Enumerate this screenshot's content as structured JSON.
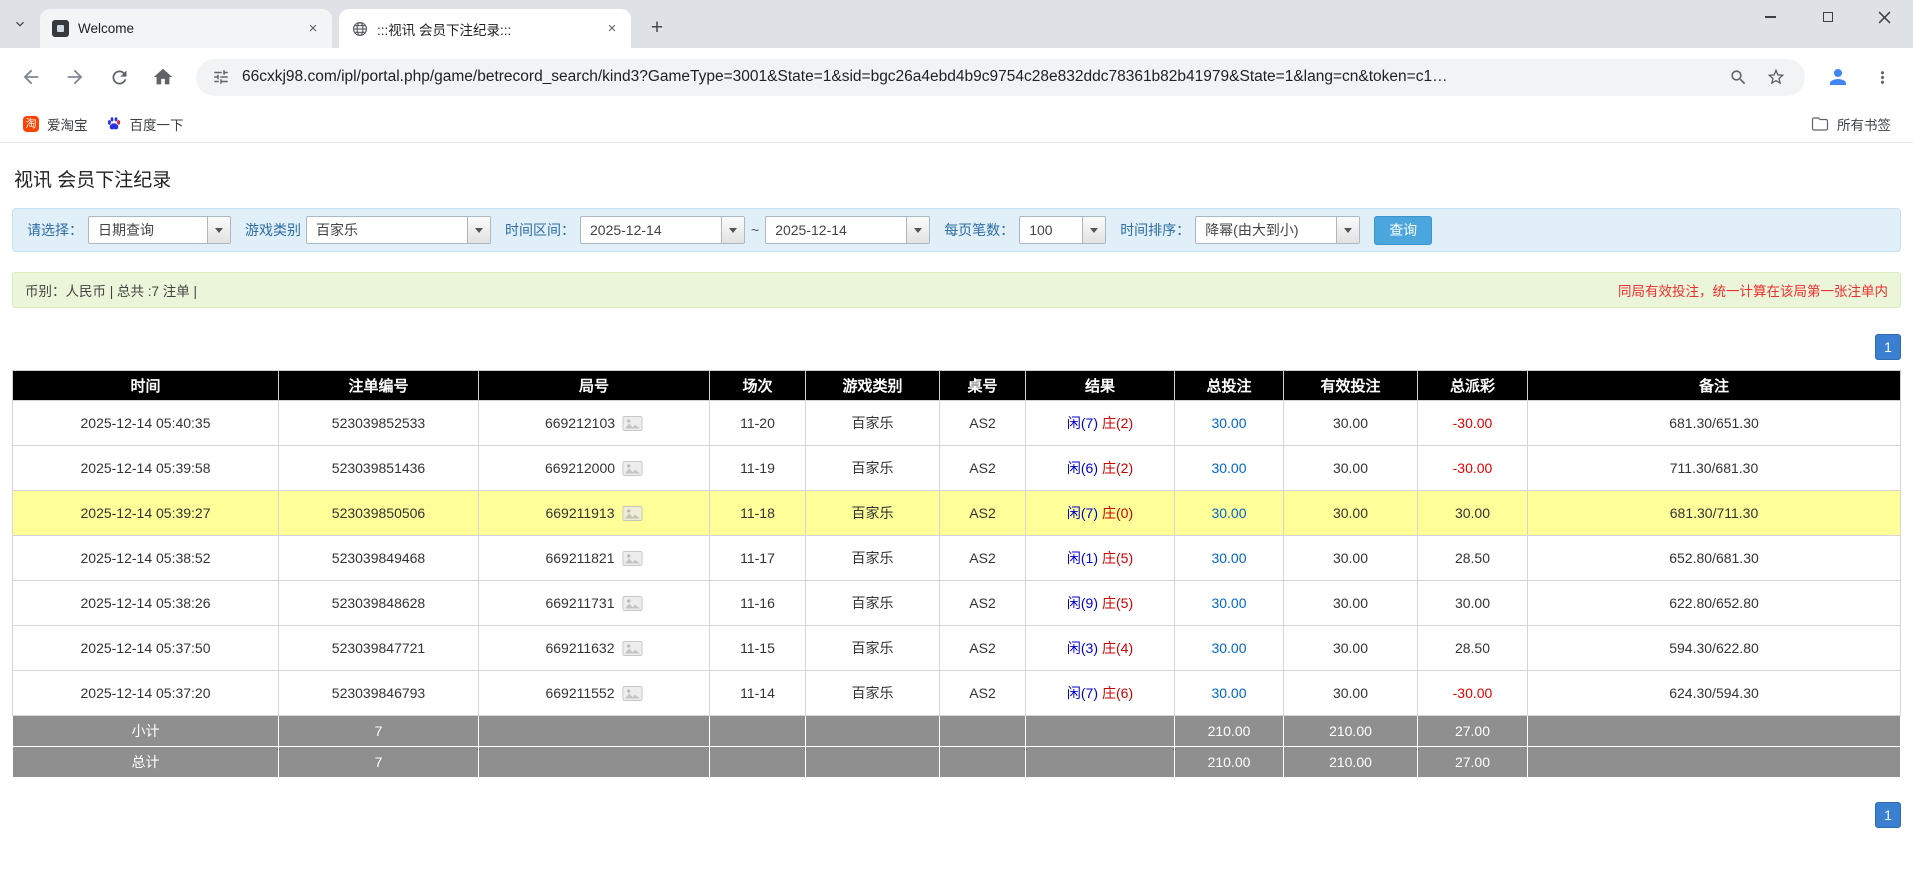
{
  "browser": {
    "icons": {
      "close_tab": "×",
      "new_tab": "+"
    },
    "tabs": [
      {
        "title": "Welcome"
      },
      {
        "title": ":::视讯 会员下注纪录:::"
      }
    ],
    "url": "66cxkj98.com/ipl/portal.php/game/betrecord_search/kind3?GameType=3001&State=1&sid=bgc26a4ebd4b9c9754c28e832ddc78361b82b41979&State=1&lang=cn&token=c1…",
    "bookmarks": {
      "items": [
        {
          "label": "爱淘宝",
          "icon_text": "淘"
        },
        {
          "label": "百度一下"
        }
      ],
      "all_bookmarks": "所有书签"
    }
  },
  "page": {
    "title": "视讯 会员下注纪录",
    "filter": {
      "select_label": "请选择：",
      "select_value": "日期查询",
      "game_label": "游戏类别",
      "game_value": "百家乐",
      "range_label": "时间区间：",
      "date_from": "2025-12-14",
      "range_separator": "~",
      "date_to": "2025-12-14",
      "page_size_label": "每页笔数：",
      "page_size_value": "100",
      "sort_label": "时间排序：",
      "sort_value": "降幂(由大到小)",
      "search_button": "查询"
    },
    "info": {
      "summary": "币别：人民币 | 总共 :7 注单 |",
      "note": "同局有效投注，统一计算在该局第一张注单内"
    },
    "pagination": {
      "page": "1"
    },
    "colors": {
      "header_bg": "#000000",
      "highlight_row": "#ffff99",
      "sum_row_bg": "#8f8f8f",
      "pager_blue": "#3a7fd0",
      "search_button_blue": "#4ba6dd",
      "player_blue": "#0000cc",
      "banker_red": "#cc0000",
      "negative_red": "#e60000",
      "note_red": "#ee2f2f",
      "filter_bar_bg": "#e1eff9",
      "info_bar_bg": "#ebf5d9"
    },
    "table": {
      "headers": [
        "时间",
        "注单编号",
        "局号",
        "场次",
        "游戏类别",
        "桌号",
        "结果",
        "总投注",
        "有效投注",
        "总派彩",
        "备注"
      ],
      "rows": [
        {
          "time": "2025-12-14 05:40:35",
          "bet_id": "523039852533",
          "round": "669212103",
          "session": "11-20",
          "game": "百家乐",
          "table_no": "AS2",
          "player": "闲(7)",
          "banker": "庄(2)",
          "total_bet": "30.00",
          "valid_bet": "30.00",
          "payout": "-30.00",
          "remark": "681.30/651.30",
          "highlight": false
        },
        {
          "time": "2025-12-14 05:39:58",
          "bet_id": "523039851436",
          "round": "669212000",
          "session": "11-19",
          "game": "百家乐",
          "table_no": "AS2",
          "player": "闲(6)",
          "banker": "庄(2)",
          "total_bet": "30.00",
          "valid_bet": "30.00",
          "payout": "-30.00",
          "remark": "711.30/681.30",
          "highlight": false
        },
        {
          "time": "2025-12-14 05:39:27",
          "bet_id": "523039850506",
          "round": "669211913",
          "session": "11-18",
          "game": "百家乐",
          "table_no": "AS2",
          "player": "闲(7)",
          "banker": "庄(0)",
          "total_bet": "30.00",
          "valid_bet": "30.00",
          "payout": "30.00",
          "remark": "681.30/711.30",
          "highlight": true
        },
        {
          "time": "2025-12-14 05:38:52",
          "bet_id": "523039849468",
          "round": "669211821",
          "session": "11-17",
          "game": "百家乐",
          "table_no": "AS2",
          "player": "闲(1)",
          "banker": "庄(5)",
          "total_bet": "30.00",
          "valid_bet": "30.00",
          "payout": "28.50",
          "remark": "652.80/681.30",
          "highlight": false
        },
        {
          "time": "2025-12-14 05:38:26",
          "bet_id": "523039848628",
          "round": "669211731",
          "session": "11-16",
          "game": "百家乐",
          "table_no": "AS2",
          "player": "闲(9)",
          "banker": "庄(5)",
          "total_bet": "30.00",
          "valid_bet": "30.00",
          "payout": "30.00",
          "remark": "622.80/652.80",
          "highlight": false
        },
        {
          "time": "2025-12-14 05:37:50",
          "bet_id": "523039847721",
          "round": "669211632",
          "session": "11-15",
          "game": "百家乐",
          "table_no": "AS2",
          "player": "闲(3)",
          "banker": "庄(4)",
          "total_bet": "30.00",
          "valid_bet": "30.00",
          "payout": "28.50",
          "remark": "594.30/622.80",
          "highlight": false
        },
        {
          "time": "2025-12-14 05:37:20",
          "bet_id": "523039846793",
          "round": "669211552",
          "session": "11-14",
          "game": "百家乐",
          "table_no": "AS2",
          "player": "闲(7)",
          "banker": "庄(6)",
          "total_bet": "30.00",
          "valid_bet": "30.00",
          "payout": "-30.00",
          "remark": "624.30/594.30",
          "highlight": false
        }
      ],
      "subtotal_row": {
        "label": "小计",
        "count": "7",
        "total_bet": "210.00",
        "valid_bet": "210.00",
        "payout": "27.00"
      },
      "total_row": {
        "label": "总计",
        "count": "7",
        "total_bet": "210.00",
        "valid_bet": "210.00",
        "payout": "27.00"
      }
    }
  }
}
